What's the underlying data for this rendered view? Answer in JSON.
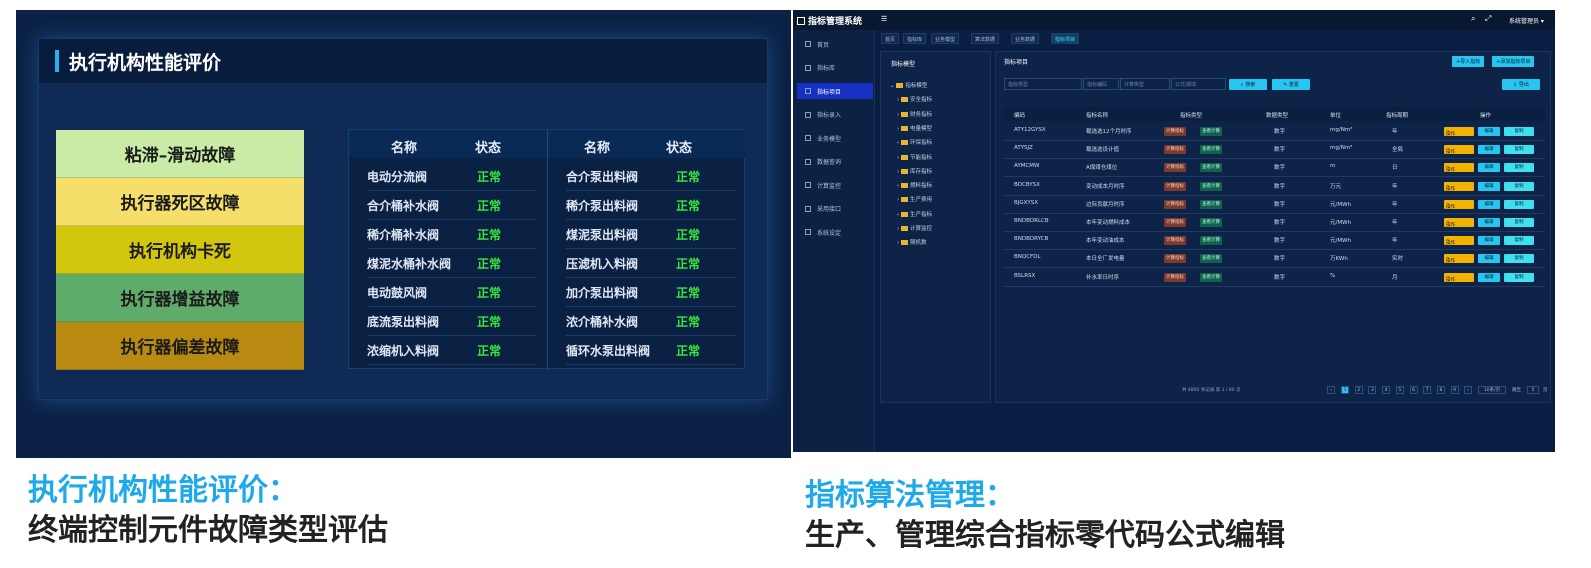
{
  "left": {
    "title": "执行机构性能评价",
    "faults": [
      {
        "label": "粘滞–滑动故障",
        "color": "#c9eba5"
      },
      {
        "label": "执行器死区故障",
        "color": "#f5df6a"
      },
      {
        "label": "执行机构卡死",
        "color": "#d2c60f"
      },
      {
        "label": "执行器增益故障",
        "color": "#5fac6a"
      },
      {
        "label": "执行器偏差故障",
        "color": "#b88a12"
      }
    ],
    "headers": {
      "name": "名称",
      "status": "状态"
    },
    "rows_left": [
      {
        "name": "电动分流阀",
        "status": "正常"
      },
      {
        "name": "合介桶补水阀",
        "status": "正常"
      },
      {
        "name": "稀介桶补水阀",
        "status": "正常"
      },
      {
        "name": "煤泥水桶补水阀",
        "status": "正常"
      },
      {
        "name": "电动鼓风阀",
        "status": "正常"
      },
      {
        "name": "底流泵出料阀",
        "status": "正常"
      },
      {
        "name": "浓缩机入料阀",
        "status": "正常"
      }
    ],
    "rows_right": [
      {
        "name": "合介泵出料阀",
        "status": "正常"
      },
      {
        "name": "稀介泵出料阀",
        "status": "正常"
      },
      {
        "name": "煤泥泵出料阀",
        "status": "正常"
      },
      {
        "name": "压滤机入料阀",
        "status": "正常"
      },
      {
        "name": "加介泵出料阀",
        "status": "正常"
      },
      {
        "name": "浓介桶补水阀",
        "status": "正常"
      },
      {
        "name": "循环水泵出料阀",
        "status": "正常"
      }
    ]
  },
  "right": {
    "app_title": "指标管理系统",
    "user": "系统管理员",
    "sidebar": [
      "首页",
      "指标库",
      "指标项目",
      "指标录入",
      "业务模型",
      "数据查询",
      "计算监控",
      "采用接口",
      "系统设定"
    ],
    "tabs": [
      "首页",
      "指标库",
      "业务模型",
      "算法数据",
      "业务数据",
      "指标项目"
    ],
    "tree_title": "指标模型",
    "tree": [
      "指标模型",
      "安全指标",
      "财务指标",
      "电量模型",
      "环保指标",
      "节能指标",
      "库存指标",
      "燃料指标",
      "生产费用",
      "生产指标",
      "计算监控",
      "随机数"
    ],
    "main_title": "指标项目",
    "buttons": {
      "import": "+导入指标",
      "add": "+添加指标项目",
      "search": "搜索",
      "reset": "重置",
      "export": "导出"
    },
    "filters": [
      "指标类型",
      "指标编码",
      "计算类型",
      "公式/脚本"
    ],
    "columns": [
      "编码",
      "指标名称",
      "指标类型",
      "数据类型",
      "单位",
      "指标周期",
      "操作"
    ],
    "rows": [
      {
        "code": "ATY12GYSX",
        "name": "载选选12个月时序",
        "dtype": "数字",
        "unit": "mg/Nm³",
        "period": "年"
      },
      {
        "code": "ATYSJZ",
        "name": "载选选设计值",
        "dtype": "数字",
        "unit": "mg/Nm³",
        "period": "全局"
      },
      {
        "code": "AYMCMW",
        "name": "A煤煤仓煤位",
        "dtype": "数字",
        "unit": "m",
        "period": "日"
      },
      {
        "code": "BDCBYSX",
        "name": "变动成本月时序",
        "dtype": "数字",
        "unit": "万元",
        "period": "年"
      },
      {
        "code": "BJGXYSX",
        "name": "边际贡献月时序",
        "dtype": "数字",
        "unit": "元/MWh",
        "period": "年"
      },
      {
        "code": "BNDBDRLCB",
        "name": "本年变动燃料成本",
        "dtype": "数字",
        "unit": "元/MWh",
        "period": "年"
      },
      {
        "code": "BNDBDRYCB",
        "name": "本年变动油成本",
        "dtype": "数字",
        "unit": "元/MWh",
        "period": "年"
      },
      {
        "code": "BNQCFDL",
        "name": "本日全厂发电量",
        "dtype": "数字",
        "unit": "万KWh",
        "period": "实时"
      },
      {
        "code": "BSLRSX",
        "name": "补水率日时序",
        "dtype": "数字",
        "unit": "%",
        "period": "月"
      }
    ],
    "row_tags": {
      "calc": "计算指标",
      "view": "查看计算"
    },
    "row_ops": {
      "op": "操作",
      "edit": "编辑",
      "copy": "复制"
    },
    "pager_text": "共 4800 条记录 第 1 / 80 页",
    "pages": [
      "1",
      "2",
      "3",
      "4",
      "5",
      "6",
      "7",
      "8",
      "9"
    ],
    "page_size": "10条/页",
    "goto_label": "跳至",
    "goto_value": "5",
    "page_unit": "页"
  },
  "captions": {
    "left_title": "执行机构性能评价：",
    "left_sub": "终端控制元件故障类型评估",
    "right_title": "指标算法管理：",
    "right_sub": "生产、管理综合指标零代码公式编辑"
  }
}
